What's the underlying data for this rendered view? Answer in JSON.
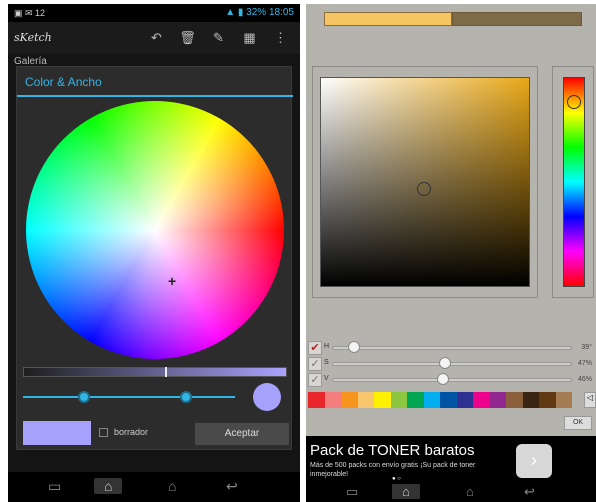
{
  "left": {
    "status": {
      "left_icons": "▣ ✉ 12",
      "right_text": "▲ ▮ 32% 18:05"
    },
    "app_logo": "sKetch",
    "toolbar_icons": [
      "undo-icon",
      "trash-icon",
      "brush-icon",
      "save-icon",
      "overflow-icon"
    ],
    "toolbar_glyphs": [
      "↶",
      "🗑",
      "✎",
      "▦",
      "⋮"
    ],
    "gallery_label": "Galería",
    "dialog": {
      "title": "Color & Ancho",
      "eraser_label": "borrador",
      "accept_label": "Aceptar",
      "selected_color": "#a6a1fb"
    },
    "nav": {
      "recent": "▭",
      "home_active": "⌂",
      "home": "⌂",
      "back": "↩"
    }
  },
  "right": {
    "compare": {
      "old_color": "#f5c563",
      "new_color": "#7e6a47"
    },
    "sliders": [
      {
        "label": "H",
        "value": "39°",
        "level": 0.07,
        "checked": true,
        "mark": "✔"
      },
      {
        "label": "S",
        "value": "47%",
        "level": 0.47,
        "checked": false,
        "mark": "✓"
      },
      {
        "label": "V",
        "value": "46%",
        "level": 0.46,
        "checked": false,
        "mark": "✓"
      }
    ],
    "palette": [
      "#e8262b",
      "#f47c7c",
      "#f7941d",
      "#f9c66e",
      "#fff200",
      "#8dc63f",
      "#00a651",
      "#00aeef",
      "#0054a6",
      "#2e3192",
      "#ec008c",
      "#92278f",
      "#8b5e3c",
      "#3c2415",
      "#603913",
      "#a67c52"
    ],
    "palette_btn": "◁",
    "ok_label": "OK",
    "ad": {
      "title": "Pack de TONER baratos",
      "line1": "Más de 500 packs con envío gratis ¡Su pack de toner",
      "line2": "inmejorable!",
      "button": "›",
      "dots": "● ○"
    },
    "nav": {
      "recent": "▭",
      "home_active": "⌂",
      "home": "⌂",
      "back": "↩"
    }
  }
}
